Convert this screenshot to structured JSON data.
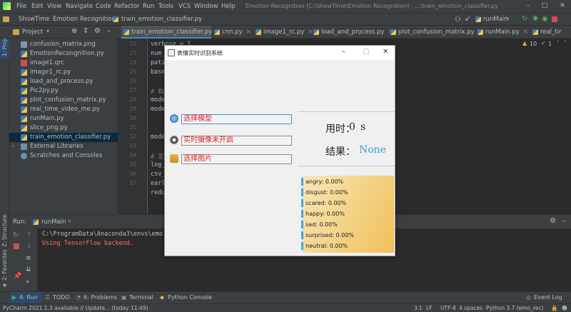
{
  "menu": [
    "File",
    "Edit",
    "View",
    "Navigate",
    "Code",
    "Refactor",
    "Run",
    "Tools",
    "VCS",
    "Window",
    "Help"
  ],
  "window_title": "Emotion Recognition [C:\\ShowTime\\Emotion Recognition] - ...\\train_emotion_classifier.py",
  "breadcrumbs": [
    "ShowTime",
    "Emotion Recognition",
    "train_emotion_classifier.py"
  ],
  "run_config": "runMain",
  "tabs": [
    "train_emotion_classifier.py",
    "cnn.py",
    "image1_rc.py",
    "load_and_process.py",
    "plot_confusion_matrix.py",
    "runMain.py",
    "real_tir"
  ],
  "side_tabs": {
    "project": "1: Project",
    "structure": "Z: Structure",
    "favorites": "2: Favorites"
  },
  "project_panel": {
    "title": "Project",
    "files": [
      "confusion_matrix.png",
      "EmotionRecongnition.py",
      "image1.qrc",
      "image1_rc.py",
      "load_and_process.py",
      "Pic2py.py",
      "plot_confusion_matrix.py",
      "real_time_video_me.py",
      "runMain.py",
      "slice_png.py",
      "train_emotion_classifier.py"
    ],
    "selected": "train_emotion_classifier.py",
    "external": "External Libraries",
    "scratches": "Scratches and Consoles"
  },
  "editor": {
    "line_numbers": [
      "22",
      "23",
      "24",
      "25",
      "26",
      "27",
      "28",
      "29",
      "30",
      "31",
      "32",
      "33",
      "34",
      "35",
      "36",
      "37"
    ],
    "lines": [
      "verbose = 1",
      "num_c",
      "patie",
      "base_",
      "",
      "# 构建",
      "model",
      "model",
      "",
      "model",
      "",
      "# 定义",
      "log_f",
      "csv_l",
      "early",
      "reduc"
    ],
    "inspection": {
      "warnings": "10",
      "weak": "1"
    }
  },
  "run_panel": {
    "label": "Run:",
    "config": "runMain",
    "output_path": "C:\\ProgramData\\Anaconda3\\envs\\emo",
    "output_msg": "Using TensorFlow backend."
  },
  "bottom_tools": [
    "4: Run",
    "TODO",
    "6: Problems",
    "Terminal",
    "Python Console"
  ],
  "event_log": "Event Log",
  "status": {
    "message": "PyCharm 2021.1.3 available // Update... (today 11:49)",
    "position": "3:1",
    "line_sep": "LF",
    "encoding": "UTF-8",
    "indent": "4 spaces",
    "interpreter": "Python 3.7 (emo_rec)"
  },
  "dialog": {
    "title": "表情实时识别系统",
    "btn_model": "选择模型",
    "btn_camera": "实时摄像未开启",
    "btn_image": "选择图片",
    "time_label": "用时：",
    "time_value": "0",
    "time_unit": "s",
    "result_label": "结果：",
    "result_value": "None",
    "emotions": [
      "angry: 0.00%",
      "disgust: 0.00%",
      "scared: 0.00%",
      "happy: 0.00%",
      "sad: 0.00%",
      "surprised: 0.00%",
      "neutral: 0.00%"
    ]
  },
  "colors": {
    "accent": "#4a88c7",
    "result_value": "#3aa0c8",
    "button_text": "#e02020"
  }
}
